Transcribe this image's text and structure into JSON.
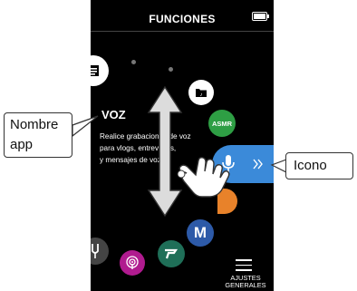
{
  "screen": {
    "title": "FUNCIONES",
    "app_name": "VOZ",
    "description_lines": [
      "Realice grabaciones de voz",
      "para vlogs, entrevistas,",
      "y mensajes de voz."
    ],
    "menu_label_line1": "AJUSTES",
    "menu_label_line2": "GENERALES",
    "asmr_label": "ASMR",
    "m_label": "M"
  },
  "annotations": {
    "app_name_line1": "Nombre",
    "app_name_line2": "app",
    "icon_label": "Icono"
  },
  "icons": {
    "gesture": "hand-swipe-icon",
    "arrow": "double-arrow-vertical-icon",
    "mic": "microphone-icon",
    "next": "double-chevron-right-icon",
    "menu": "hamburger-menu-icon"
  },
  "colors": {
    "screen_background": "#000000",
    "voice_pill": "#3b8ad9",
    "asmr_green": "#2e9e44",
    "m_blue": "#2d5aa8",
    "podcast_purple": "#b01b8f",
    "green_icon": "#1f6f58",
    "orange_icon": "#e8822a"
  }
}
